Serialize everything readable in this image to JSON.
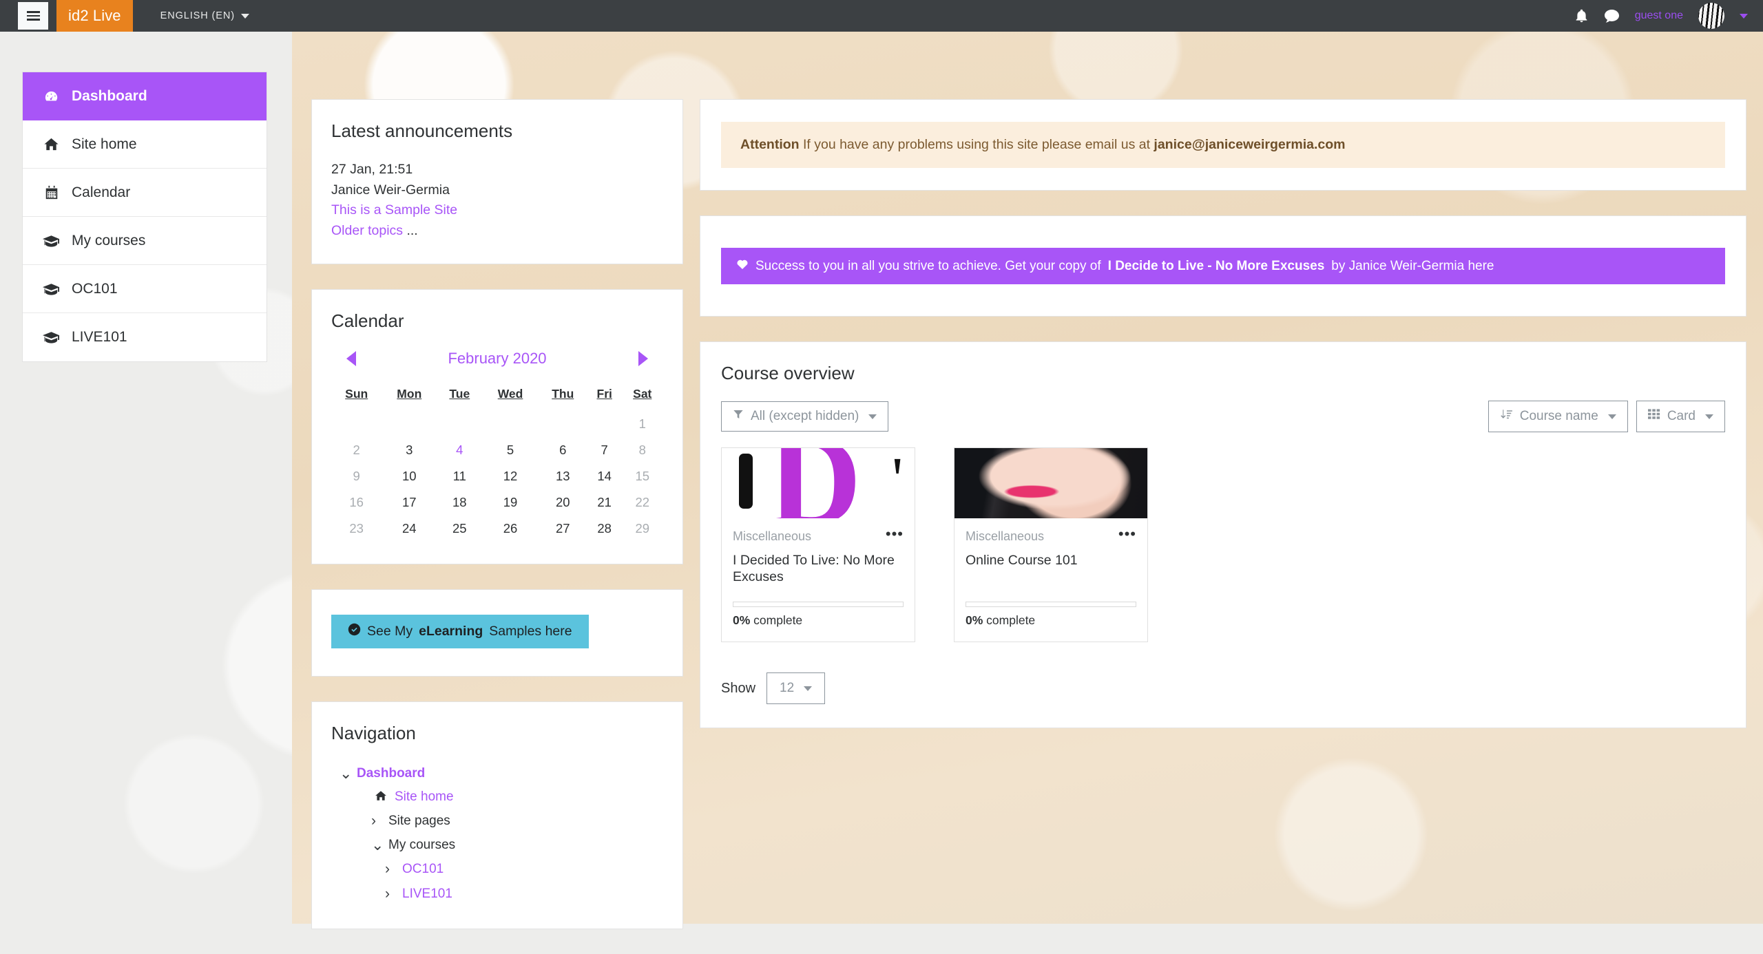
{
  "navbar": {
    "menu_icon": "hamburger-icon",
    "brand": "id2 Live",
    "language": "ENGLISH (EN)",
    "bell_icon": "notification-bell-icon",
    "message_icon": "message-bubble-icon",
    "user_name": "guest one",
    "avatar": "user-avatar"
  },
  "sidebar": {
    "items": [
      {
        "label": "Dashboard",
        "icon": "dashboard-gauge-icon",
        "active": true
      },
      {
        "label": "Site home",
        "icon": "home-icon",
        "active": false
      },
      {
        "label": "Calendar",
        "icon": "calendar-icon",
        "active": false
      },
      {
        "label": "My courses",
        "icon": "graduation-cap-icon",
        "active": false
      },
      {
        "label": "OC101",
        "icon": "graduation-cap-icon",
        "active": false
      },
      {
        "label": "LIVE101",
        "icon": "graduation-cap-icon",
        "active": false
      }
    ]
  },
  "announcements": {
    "title": "Latest announcements",
    "date": "27 Jan, 21:51",
    "author": "Janice Weir-Germia",
    "subject": "This is a Sample Site",
    "older": "Older topics",
    "older_suffix": " ..."
  },
  "calendar": {
    "title": "Calendar",
    "month": "February 2020",
    "prev_icon": "caret-left-icon",
    "next_icon": "caret-right-icon",
    "weekdays": [
      "Sun",
      "Mon",
      "Tue",
      "Wed",
      "Thu",
      "Fri",
      "Sat"
    ],
    "weeks": [
      [
        null,
        null,
        null,
        null,
        null,
        null,
        1
      ],
      [
        2,
        3,
        4,
        5,
        6,
        7,
        8
      ],
      [
        9,
        10,
        11,
        12,
        13,
        14,
        15
      ],
      [
        16,
        17,
        18,
        19,
        20,
        21,
        22
      ],
      [
        23,
        24,
        25,
        26,
        27,
        28,
        29
      ]
    ],
    "today": 4,
    "weekend_columns": [
      0,
      6
    ]
  },
  "elearning_promo": {
    "icon": "check-circle-icon",
    "prefix": "See My ",
    "bold": "eLearning",
    "suffix": " Samples here"
  },
  "navigation": {
    "title": "Navigation",
    "tree": [
      {
        "label": "Dashboard",
        "level": 0,
        "chevron": "chevron-down-icon",
        "style": "purple-bold",
        "icon": null
      },
      {
        "label": "Site home",
        "level": 1,
        "chevron": null,
        "style": "purple",
        "icon": "home-icon"
      },
      {
        "label": "Site pages",
        "level": 2,
        "chevron": "chevron-right-icon",
        "style": "dark",
        "icon": null
      },
      {
        "label": "My courses",
        "level": 2,
        "chevron": "chevron-down-icon",
        "style": "dark",
        "icon": null
      },
      {
        "label": "OC101",
        "level": 3,
        "chevron": "chevron-right-icon",
        "style": "purple",
        "icon": null
      },
      {
        "label": "LIVE101",
        "level": 3,
        "chevron": "chevron-right-icon",
        "style": "purple",
        "icon": null
      }
    ]
  },
  "alert": {
    "bold": "Attention",
    "text": " If you have any problems using this site please email us at ",
    "email": "janice@janiceweirgermia.com"
  },
  "promo": {
    "icon": "heart-icon",
    "text_before": "Success to you in all you strive to achieve. Get your copy of ",
    "book_title": "I Decide to Live - No More Excuses",
    "text_after": " by Janice Weir-Germia here"
  },
  "course_overview": {
    "title": "Course overview",
    "filter": {
      "label": "All (except hidden)",
      "icon": "filter-funnel-icon"
    },
    "sort": {
      "label": "Course name",
      "icon": "sort-amount-down-icon"
    },
    "view": {
      "label": "Card",
      "icon": "grid-view-icon"
    },
    "show_label": "Show",
    "show_value": "12",
    "courses": [
      {
        "category": "Miscellaneous",
        "name": "I Decided To Live: No More Excuses",
        "progress_percent": 0,
        "progress_text": "0%",
        "progress_suffix": " complete",
        "menu_icon": "ellipsis-icon",
        "image": "book-cover-id-image"
      },
      {
        "category": "Miscellaneous",
        "name": "Online Course 101",
        "progress_percent": 0,
        "progress_text": "0%",
        "progress_suffix": " complete",
        "menu_icon": "ellipsis-icon",
        "image": "woman-portrait-image"
      }
    ]
  },
  "colors": {
    "brand_orange": "#e8821e",
    "accent_purple": "#a855f7",
    "navbar_dark": "#3c4043",
    "teal": "#5bc3dd",
    "alert_bg": "#fbeedd"
  }
}
